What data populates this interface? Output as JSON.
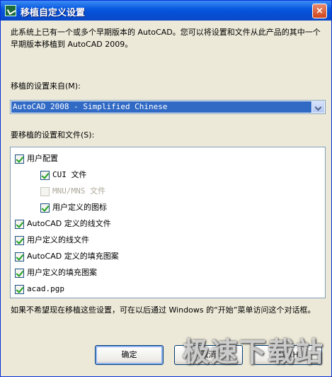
{
  "window": {
    "title": "移植自定义设置",
    "close_label": "×"
  },
  "description": "此系统上已有一个或多个早期版本的 AutoCAD。您可以将设置和文件从此产品的其中一个早期版本移植到 AutoCAD 2009。",
  "source": {
    "label": "移植的设置来自(M):",
    "selected": "AutoCAD 2008 - Simplified Chinese"
  },
  "items": {
    "label": "要移植的设置和文件(S):",
    "list": [
      {
        "label": "用户配置",
        "checked": true,
        "disabled": false,
        "indent": 0
      },
      {
        "label": "CUI 文件",
        "checked": true,
        "disabled": false,
        "indent": 1
      },
      {
        "label": "MNU/MNS 文件",
        "checked": false,
        "disabled": true,
        "indent": 1
      },
      {
        "label": "用户定义的图标",
        "checked": true,
        "disabled": false,
        "indent": 1
      },
      {
        "label": "AutoCAD 定义的线文件",
        "checked": true,
        "disabled": false,
        "indent": 0
      },
      {
        "label": "用户定义的线文件",
        "checked": true,
        "disabled": false,
        "indent": 0
      },
      {
        "label": "AutoCAD 定义的填充图案",
        "checked": true,
        "disabled": false,
        "indent": 0
      },
      {
        "label": "用户定义的填充图案",
        "checked": true,
        "disabled": false,
        "indent": 0
      },
      {
        "label": "acad.pgp",
        "checked": true,
        "disabled": false,
        "indent": 0
      }
    ]
  },
  "note": "如果不希望现在移植这些设置，可在以后通过 Windows 的“开始”菜单访问这个对话框。",
  "buttons": {
    "ok": "确定",
    "cancel": "取消",
    "help": "帮助(H)"
  },
  "watermark": "极速下载站"
}
